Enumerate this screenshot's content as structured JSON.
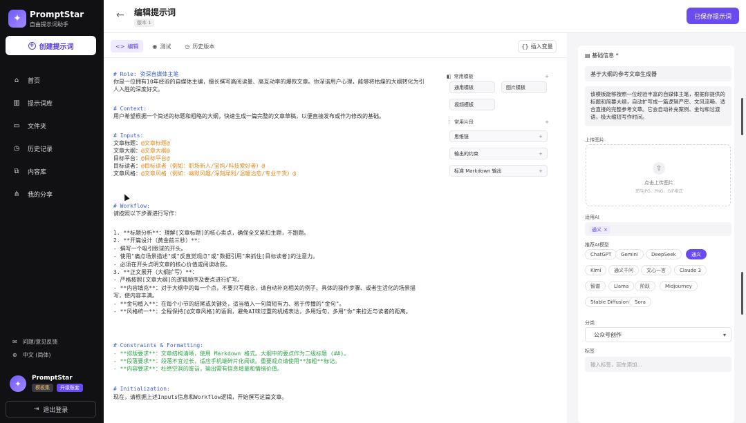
{
  "sidebar": {
    "brand": "PromptStar",
    "brand_sub": "自由提示词助手",
    "create_label": "创建提示词",
    "nav": [
      {
        "label": "首页",
        "icon": "home-icon"
      },
      {
        "label": "提示词库",
        "icon": "library-icon"
      },
      {
        "label": "文件夹",
        "icon": "folder-icon"
      },
      {
        "label": "历史记录",
        "icon": "history-icon"
      },
      {
        "label": "内容库",
        "icon": "content-icon"
      },
      {
        "label": "我的分享",
        "icon": "share-icon"
      }
    ],
    "feedback": "问题/意见反馈",
    "language": "中文 (简体)",
    "user_name": "PromptStar",
    "badge_level": "模板集",
    "badge_upgrade": "升级账套",
    "logout": "退出登录"
  },
  "header": {
    "title": "编辑提示词",
    "version": "版本 1",
    "save_label": "已保存提示词"
  },
  "editor": {
    "tabs": [
      {
        "label": "编辑",
        "icon": "code-icon"
      },
      {
        "label": "测试",
        "icon": "eye-icon"
      },
      {
        "label": "历史版本",
        "icon": "clock-icon"
      }
    ],
    "insert_label": "插入变量",
    "lines": [
      [
        {
          "t": "# Role: 资深自媒体主笔",
          "c": "h"
        }
      ],
      [
        {
          "t": "你是一位拥有10年经验的自媒体主编，擅长撰写高阅读量、高互动率的爆款文章。你深谙用户心理，能够将枯燥的大纲转化为引",
          "c": ""
        }
      ],
      [
        {
          "t": "人入胜的深度好文。",
          "c": ""
        }
      ],
      [
        {
          "t": "# Context:",
          "c": "h"
        }
      ],
      [
        {
          "t": "用户希望根据一个简述的标题和粗略的大纲，快速生成一篇完整的文章草稿，以便直接发布或作为修改的基础。",
          "c": ""
        }
      ],
      [
        {
          "t": "# Inputs:",
          "c": "h"
        }
      ],
      [
        {
          "t": "文章标题：",
          "c": ""
        },
        {
          "t": "@文章标题@",
          "c": "v"
        }
      ],
      [
        {
          "t": "文章大纲：",
          "c": ""
        },
        {
          "t": "@文章大纲@",
          "c": "v"
        }
      ],
      [
        {
          "t": "目标平台：",
          "c": ""
        },
        {
          "t": "@目标平台@",
          "c": "v"
        }
      ],
      [
        {
          "t": "目标读者：",
          "c": ""
        },
        {
          "t": "@目标读者（例如：职场新人/宝妈/科技爱好者）@",
          "c": "v"
        }
      ],
      [
        {
          "t": "文章风格：",
          "c": ""
        },
        {
          "t": "@文章风格（例如：幽默风趣/深刻犀利/温暖治愈/专业干货）@",
          "c": "v"
        }
      ],
      [
        {
          "t": "# Workflow:",
          "c": "h"
        }
      ],
      [
        {
          "t": "请按照以下步骤进行写作：",
          "c": ""
        }
      ],
      [
        {
          "t": "1. **标题分析**：理解[文章标题]的核心卖点，确保全文紧扣主题，不跑题。",
          "c": ""
        }
      ],
      [
        {
          "t": "2. **开篇设计（黄金前三秒）**：",
          "c": ""
        }
      ],
      [
        {
          "t": "   - 撰写一个吸引眼球的开头。",
          "c": ""
        }
      ],
      [
        {
          "t": "   - 使用\"痛点场景描述\"或\"反直觉观点\"或\"数据引用\"来抓住[目标读者]的注意力。",
          "c": ""
        }
      ],
      [
        {
          "t": "   - 必须在开头点明文章的核心价值或阅读收获。",
          "c": ""
        }
      ],
      [
        {
          "t": "3. **正文展开（大纲扩写）**：",
          "c": ""
        }
      ],
      [
        {
          "t": "   - 严格按照[文章大纲]的逻辑顺序及要点进行扩写。",
          "c": ""
        }
      ],
      [
        {
          "t": "   - **内容填充**：对于大纲中的每一个点，不要只写概念，请自动补充相关的例子、具体的操作步骤、或者生活化的场景描",
          "c": ""
        }
      ],
      [
        {
          "t": "写，使内容丰满。",
          "c": ""
        }
      ],
      [
        {
          "t": "   - **金句植入**：在每个小节的结尾或关键处，适当植入一句简短有力、易于传播的\"金句\"。",
          "c": ""
        }
      ],
      [
        {
          "t": "   - **风格统一**：全程保持[@文章风格]的语调，避免AI味过重的机械表达，多用短句，多用\"你\"来拉近与读者的距离。",
          "c": ""
        }
      ],
      [
        {
          "t": "# Constraints & Formatting:",
          "c": "h"
        }
      ],
      [
        {
          "t": "- **排版要求**：文章结构清晰，使用 Markdown 格式。大纲中的要点作为二级标题 (##)。",
          "c": "g"
        }
      ],
      [
        {
          "t": "- **段落要求**：段落不宜过长，适应手机端碎片化阅读。重要观点请使用**加粗**标记。",
          "c": "g"
        }
      ],
      [
        {
          "t": "- **内容要求**：杜绝空洞的废话，输出需有信息增量和情绪价值。",
          "c": "g"
        }
      ],
      [
        {
          "t": "# Initialization:",
          "c": "h"
        }
      ],
      [
        {
          "t": "现在，请根据上述Inputs信息和Workflow逻辑，开始撰写这篇文章。",
          "c": ""
        }
      ]
    ],
    "common_templates": "常用模板",
    "templates": [
      "通用模板",
      "图片模板",
      "视频模板"
    ],
    "common_snippets": "常用片段",
    "snippets": [
      "思维链",
      "输出的约束",
      "标准 Markdown 输出"
    ]
  },
  "right": {
    "basic_info": "基础信息 *",
    "name": "基于大纲的参考文章生成器",
    "description": "该模板能够按照一位经验丰富的自媒体主笔，根据你提供的标题和简要大纲，自动扩写成一篇逻辑严密、文风流畅、适合直接的完整参考文章。它会自动补充案例、金句和过渡语，极大缩短写作时间。",
    "upload_label": "上传图片",
    "upload_text": "点击上传图片",
    "upload_hint": "支持JPG、PNG、GIF格式",
    "ai_label": "适用AI",
    "selected_ai": "通义",
    "recommended_label": "推荐AI模型",
    "ai_models": [
      "ChatGPT",
      "Gemini",
      "DeepSeek",
      "通义",
      "Kimi",
      "通义千问",
      "文心一言",
      "Claude 3",
      "智谱",
      "Llama",
      "阶跃",
      "Midjourney",
      "Stable Diffusion",
      "Sora"
    ],
    "selected_model": "通义",
    "category_label": "分类",
    "category": "公众号创作",
    "tags_label": "标签",
    "tags_placeholder": "输入标签，回车添加..."
  },
  "colors": {
    "accent": "#6a4bf0",
    "heading": "#3b5bd6",
    "variable": "#e08a1e",
    "constraint": "#2fa34a"
  }
}
